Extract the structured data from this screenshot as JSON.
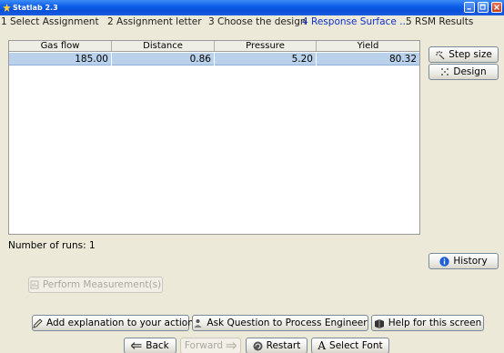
{
  "window": {
    "title": "Statlab 2.3"
  },
  "steps": [
    {
      "label": "1 Select Assignment"
    },
    {
      "label": "2 Assignment letter"
    },
    {
      "label": "3 Choose the design"
    },
    {
      "label": "4 Response Surface ..."
    },
    {
      "label": "5 RSM Results"
    }
  ],
  "table": {
    "headers": [
      "Gas flow",
      "Distance",
      "Pressure",
      "Yield"
    ],
    "rows": [
      [
        "185.00",
        "0.86",
        "5.20",
        "80.32"
      ]
    ]
  },
  "side_buttons": {
    "step_size": "Step size",
    "design": "Design",
    "history": "History"
  },
  "runs_text": "Number of runs: 1",
  "perform_label": "Perform Measurement(s)",
  "bottom": {
    "explain": "Add explanation to your action",
    "ask": "Ask Question to Process Engineer",
    "help": "Help for this screen",
    "back": "Back",
    "forward": "Forward",
    "restart": "Restart",
    "font": "Select Font"
  },
  "colors": {
    "title_bar": "#0A4FD8",
    "active_step": "#1030CC",
    "selected_row": "#B9D1EA"
  }
}
